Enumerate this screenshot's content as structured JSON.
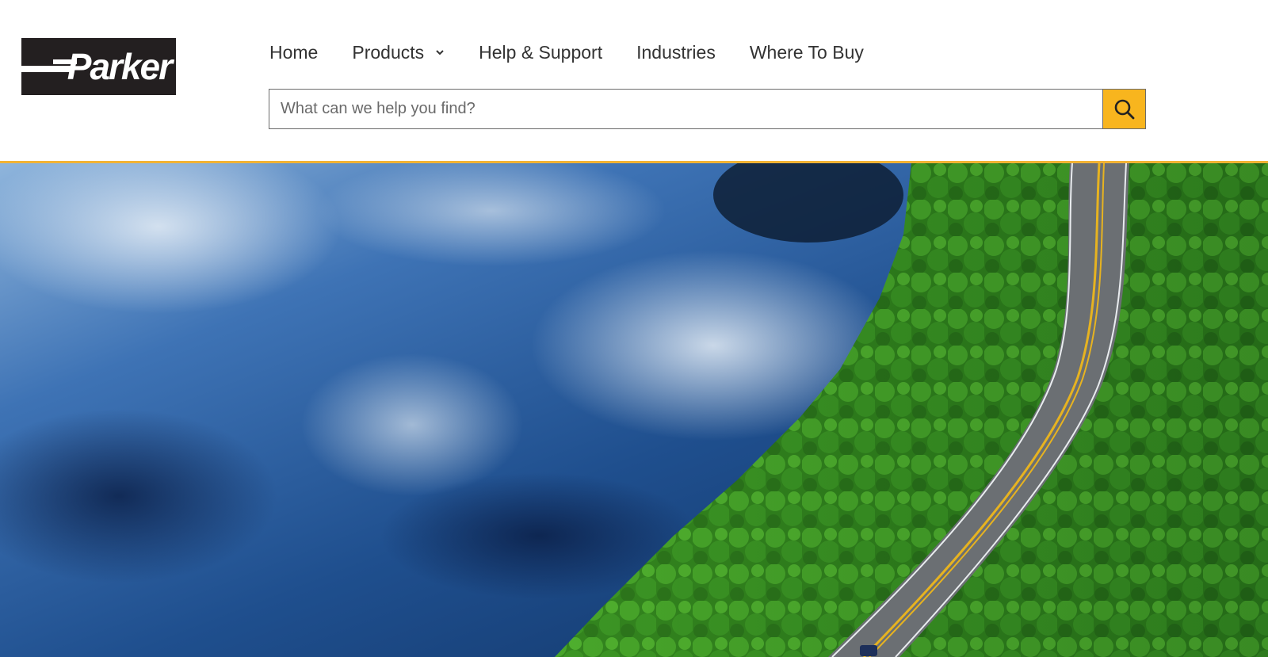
{
  "brand": {
    "name": "Parker",
    "logo_bg": "#231f20"
  },
  "nav": {
    "items": [
      {
        "label": "Home"
      },
      {
        "label": "Products",
        "has_dropdown": true
      },
      {
        "label": "Help & Support"
      },
      {
        "label": "Industries"
      },
      {
        "label": "Where To Buy"
      }
    ]
  },
  "search": {
    "placeholder": "What can we help you find?",
    "value": "",
    "button_icon": "search-icon",
    "button_color": "#f8b51e"
  },
  "accent_color": "#f2b335",
  "hero": {
    "description_icon": "aerial-lake-forest-road-image"
  }
}
